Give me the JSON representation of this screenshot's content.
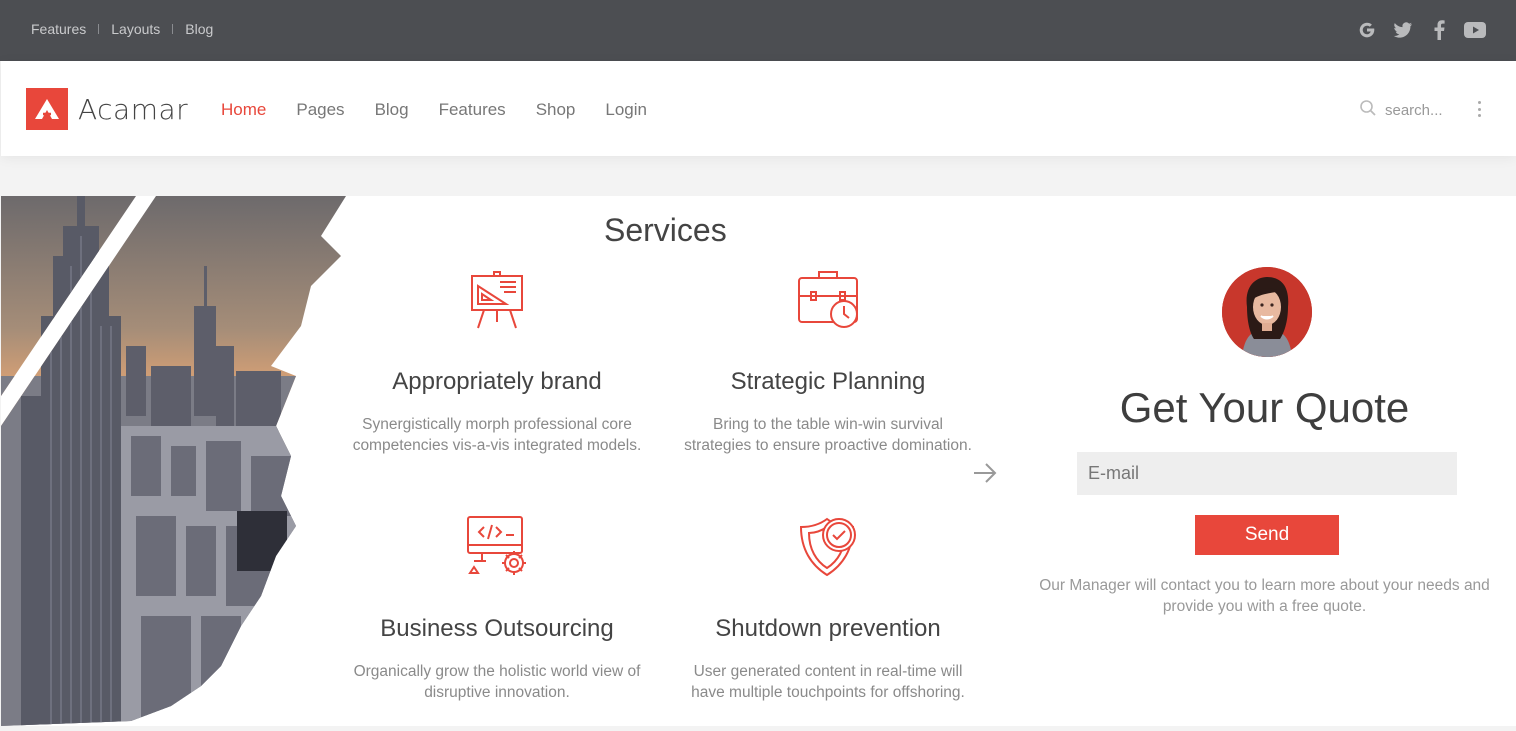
{
  "topbar": {
    "links": [
      "Features",
      "Layouts",
      "Blog"
    ],
    "social_icons": [
      "google-icon",
      "twitter-icon",
      "facebook-icon",
      "youtube-icon"
    ]
  },
  "header": {
    "brand": "Acamar",
    "nav": [
      "Home",
      "Pages",
      "Blog",
      "Features",
      "Shop",
      "Login"
    ],
    "active_nav": "Home",
    "search_placeholder": "search..."
  },
  "services": {
    "title": "Services",
    "items": [
      {
        "title": "Appropriately brand",
        "text": "Synergistically morph professional core competencies vis-a-vis integrated models.",
        "icon": "presentation-board-icon"
      },
      {
        "title": "Strategic Planning",
        "text": "Bring to the table win-win survival strategies to ensure proactive domination.",
        "icon": "briefcase-clock-icon"
      },
      {
        "title": "Business Outsourcing",
        "text": "Organically grow the holistic world view of disruptive innovation.",
        "icon": "monitor-code-icon"
      },
      {
        "title": "Shutdown prevention",
        "text": "User generated content in real-time will have multiple touchpoints for offshoring.",
        "icon": "shield-clock-icon"
      }
    ]
  },
  "quote": {
    "title": "Get Your Quote",
    "email_placeholder": "E-mail",
    "send_label": "Send",
    "note": "Our Manager will contact you to learn more about your needs and provide you with a free quote."
  },
  "colors": {
    "accent": "#e8473b",
    "topbar": "#4c4e52"
  }
}
